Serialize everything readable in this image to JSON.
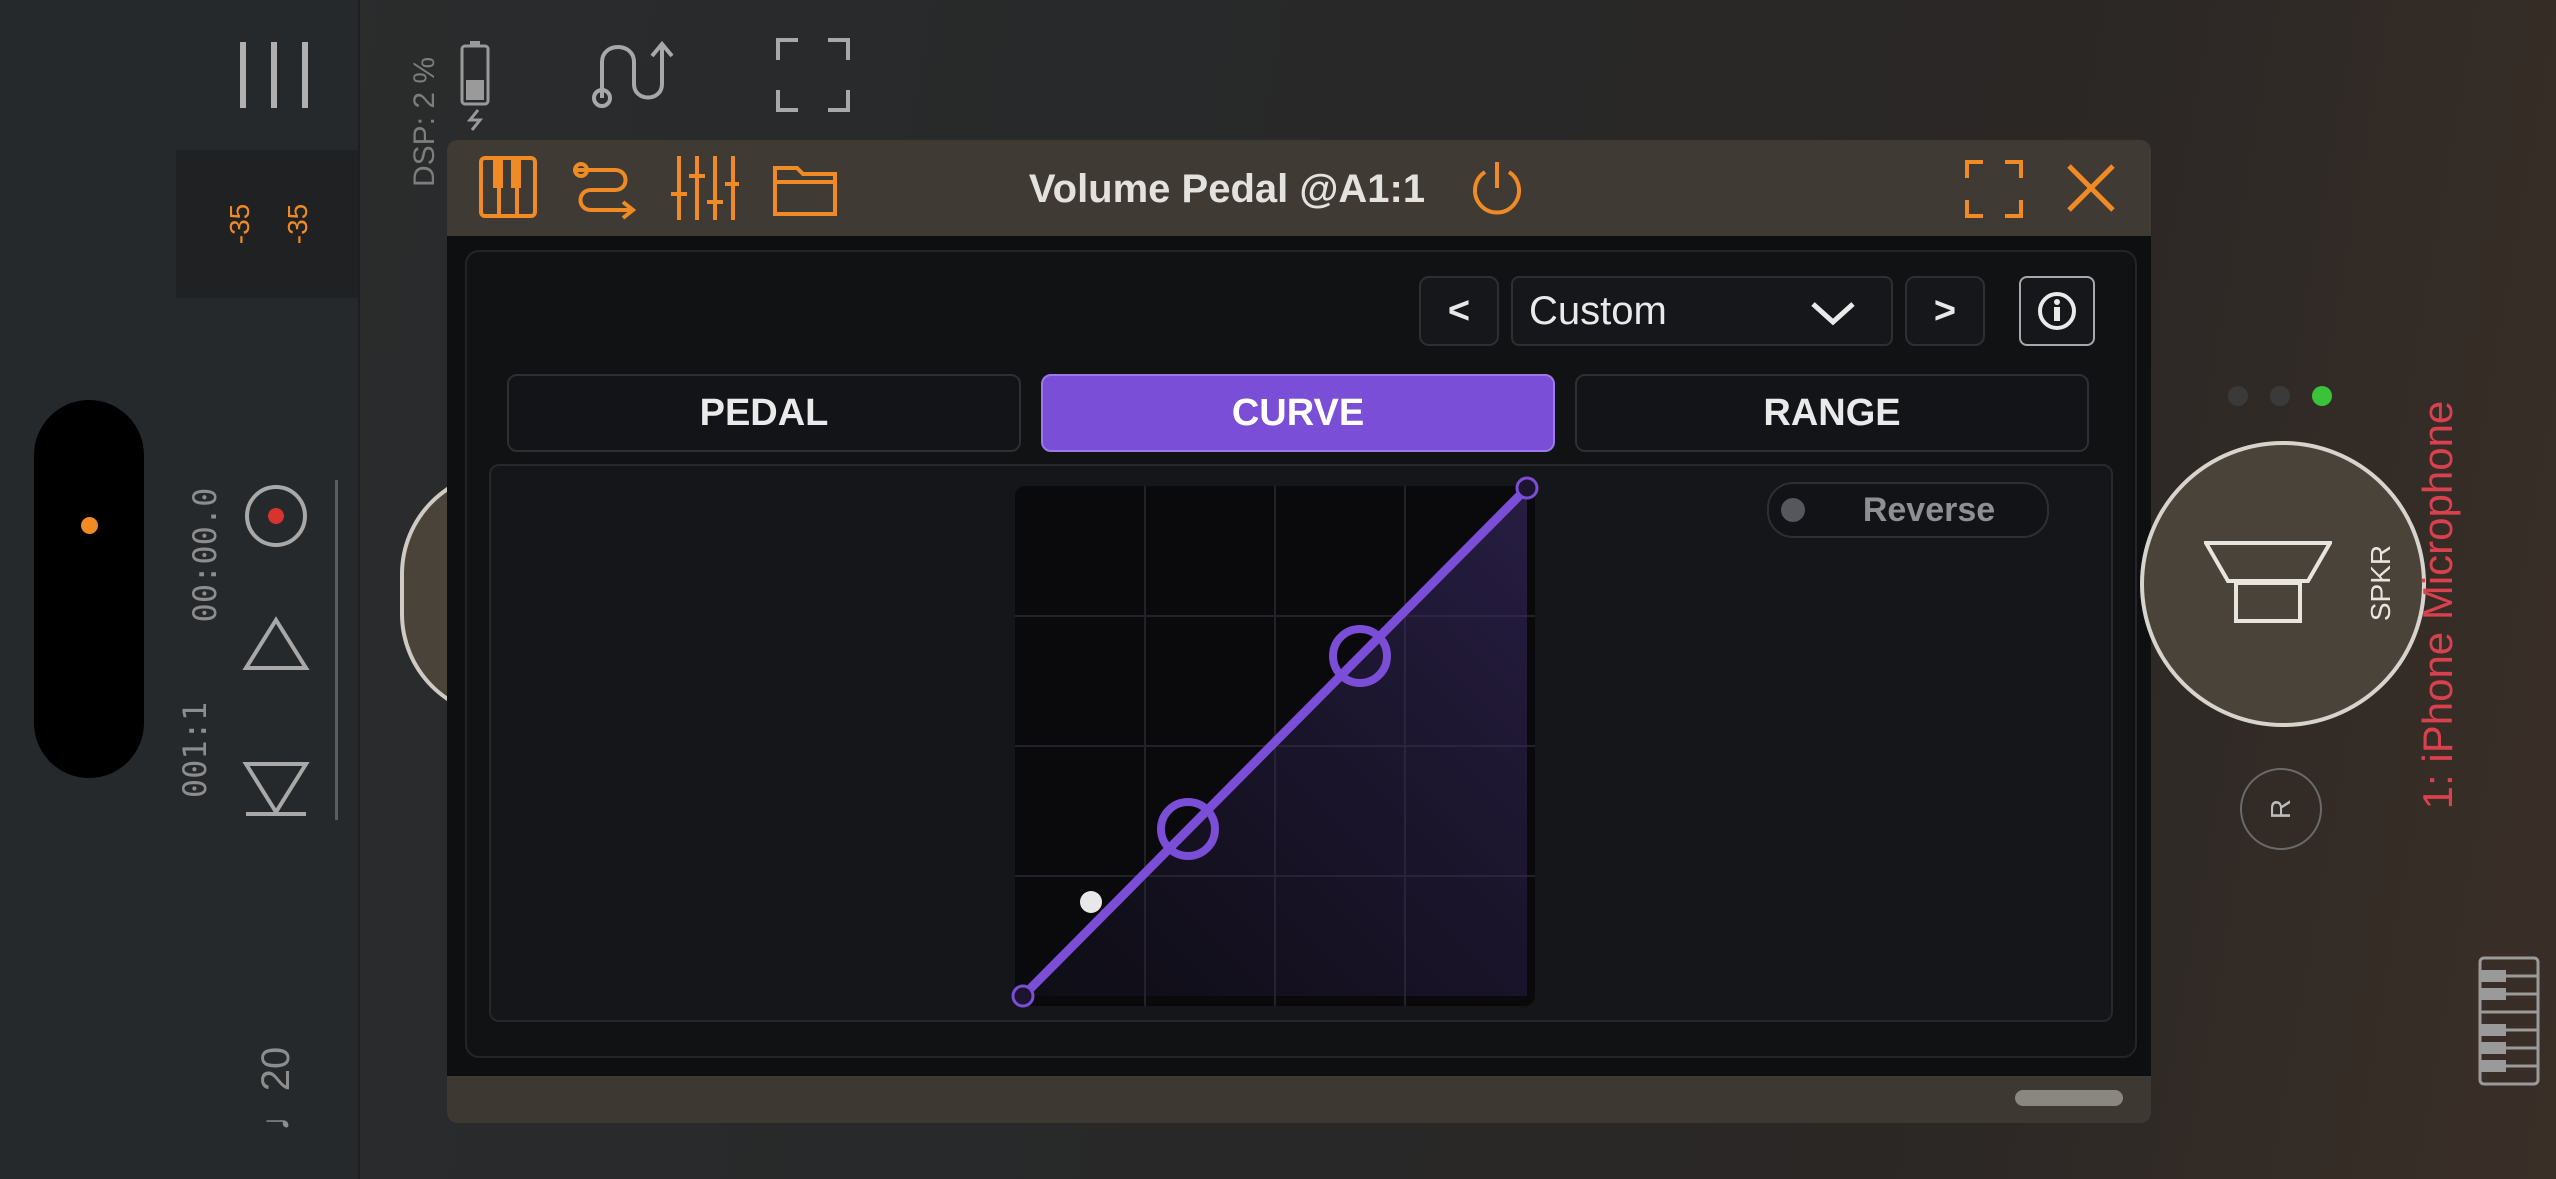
{
  "left_panel": {
    "meter_left": "-35",
    "meter_right": "-35",
    "time": "00:00.0",
    "position": "001:1",
    "tempo": "♩20"
  },
  "top_bar": {
    "dsp_label": "DSP: 2 %"
  },
  "plugin": {
    "title": "Volume Pedal @A1:1",
    "preset_value": "Custom",
    "prev_label": "<",
    "next_label": ">",
    "tabs": [
      {
        "label": "PEDAL",
        "active": false
      },
      {
        "label": "CURVE",
        "active": true
      },
      {
        "label": "RANGE",
        "active": false
      }
    ],
    "reverse_label": "Reverse",
    "reverse_on": false,
    "accent_color": "#7a4ed6"
  },
  "right_panel": {
    "output_label": "SPKR",
    "r_button": "R",
    "track_name": "1: iPhone Microphone",
    "track_color": "#d9414f"
  },
  "icons": [
    "menu-icon",
    "battery-icon",
    "routing-icon",
    "fullscreen-icon",
    "keyboard-icon",
    "wires-icon",
    "mixer-icon",
    "folder-icon",
    "power-icon",
    "expand-icon",
    "close-icon",
    "record-icon",
    "up-triangle-icon",
    "down-triangle-icon",
    "chevron-down-icon",
    "info-icon",
    "speaker-icon",
    "piano-icon"
  ]
}
